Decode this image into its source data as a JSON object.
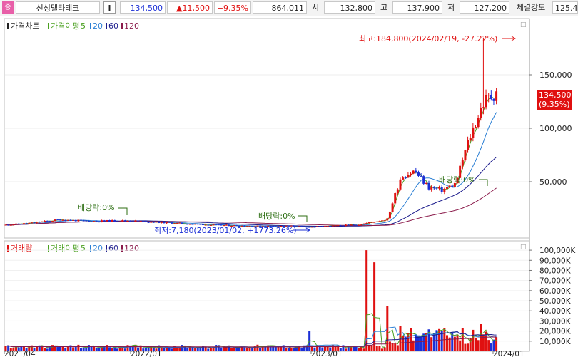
{
  "header": {
    "market_badge": "증",
    "stock_name": "신성델타테크",
    "info_button": "i",
    "price": "134,500",
    "change": "▲11,500",
    "change_pct": "+9.35%",
    "volume": "864,011",
    "open_label": "시",
    "open": "132,800",
    "high_label": "고",
    "high": "137,900",
    "low_label": "저",
    "low": "127,200",
    "strength_label": "체결강도",
    "strength": "125.4"
  },
  "price_panel": {
    "legend_chart": "가격차트",
    "legend_ma_label": "가격이평",
    "ma_periods": [
      "5",
      "20",
      "60",
      "120"
    ],
    "ma_colors": [
      "#4aa020",
      "#2b7fd4",
      "#1c1c8c",
      "#8a1a4a"
    ],
    "y_ticks": [
      "150,000",
      "100,000",
      "50,000"
    ],
    "y_tick_values": [
      150000,
      100000,
      50000
    ],
    "y_min": 0,
    "y_max": 200000,
    "current_price_tag": "134,500",
    "current_pct_tag": "(9.35%)",
    "high_annotation": "최고:184,800(2024/02/19, -27.22%)",
    "low_annotation": "최저:7,180(2023/01/02, +1773.26%)",
    "dividend_labels": [
      "배당락:0%",
      "배당락:0%",
      "배당락:0%"
    ]
  },
  "volume_panel": {
    "legend_label": "거래량",
    "legend_ma_label": "거래이평",
    "ma_periods": [
      "5",
      "20",
      "60",
      "120"
    ],
    "y_ticks": [
      "100,000K",
      "90,000K",
      "80,000K",
      "70,000K",
      "60,000K",
      "50,000K",
      "40,000K",
      "30,000K",
      "20,000K",
      "10,000K"
    ],
    "y_tick_values": [
      100000,
      90000,
      80000,
      70000,
      60000,
      50000,
      40000,
      30000,
      20000,
      10000
    ],
    "y_min": 0,
    "y_max": 105000,
    "unit": "K"
  },
  "x_axis": {
    "labels": [
      "2021/04",
      "2022/01",
      "2023/01",
      "2024/01"
    ]
  },
  "chart_data": {
    "type": "candlestick",
    "xlabel": "",
    "ylabel": "",
    "ylim": [
      0,
      200000
    ],
    "volume_ylim": [
      0,
      105000
    ],
    "price_high": {
      "value": 184800,
      "date": "2024/02/19",
      "pct": "-27.22%"
    },
    "price_low": {
      "value": 7180,
      "date": "2023/01/02",
      "pct": "+1773.26%"
    },
    "monthly_close": [
      {
        "month": "2021/03",
        "close": 9500
      },
      {
        "month": "2021/05",
        "close": 11500
      },
      {
        "month": "2021/07",
        "close": 14500
      },
      {
        "month": "2021/09",
        "close": 13000
      },
      {
        "month": "2021/12",
        "close": 13500
      },
      {
        "month": "2022/03",
        "close": 11500
      },
      {
        "month": "2022/06",
        "close": 9500
      },
      {
        "month": "2022/09",
        "close": 8500
      },
      {
        "month": "2022/12",
        "close": 8500
      },
      {
        "month": "2023/01",
        "close": 7500
      },
      {
        "month": "2023/03",
        "close": 8500
      },
      {
        "month": "2023/05",
        "close": 10000
      },
      {
        "month": "2023/07",
        "close": 15000
      },
      {
        "month": "2023/08",
        "close": 55000
      },
      {
        "month": "2023/09",
        "close": 60000
      },
      {
        "month": "2023/10",
        "close": 45000
      },
      {
        "month": "2023/11",
        "close": 42000
      },
      {
        "month": "2023/12",
        "close": 48000
      },
      {
        "month": "2024/01",
        "close": 90000
      },
      {
        "month": "2024/02",
        "close": 123000
      },
      {
        "month": "2024/03",
        "close": 134500
      }
    ],
    "volume_peaks_k": [
      {
        "month": "2023/08",
        "volume": 100000
      },
      {
        "month": "2023/08",
        "volume": 88000
      },
      {
        "month": "2023/08",
        "volume": 45000
      },
      {
        "month": "2023/01",
        "volume": 20000
      },
      {
        "month": "2024/02",
        "volume": 27000
      },
      {
        "month": "2024/01",
        "volume": 23000
      }
    ]
  }
}
